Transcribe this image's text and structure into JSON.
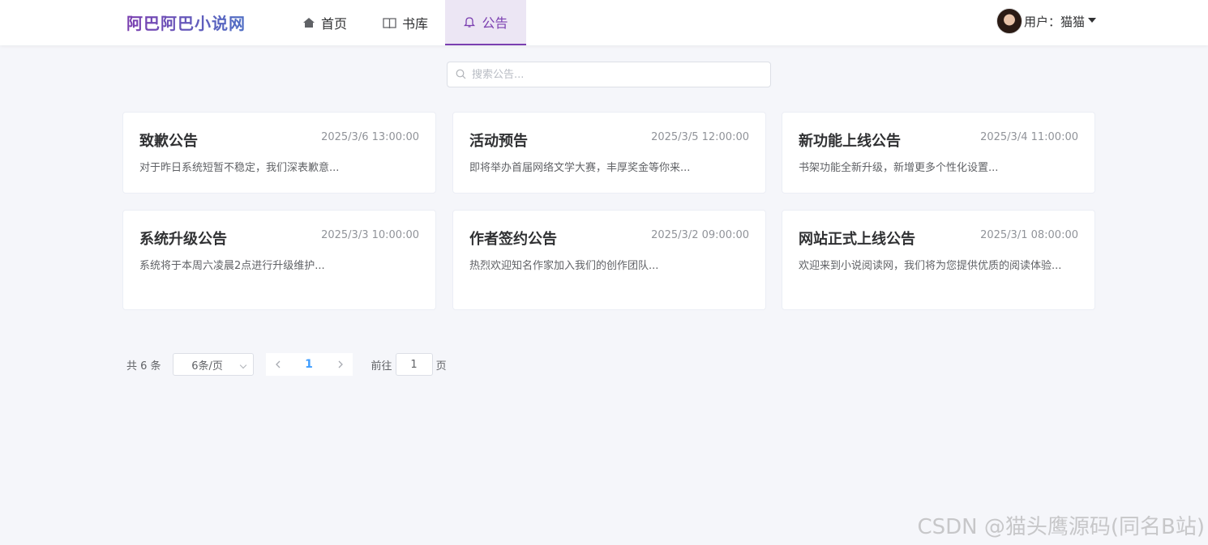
{
  "app": {
    "logo": "阿巴阿巴小说网"
  },
  "nav": {
    "home": "首页",
    "library": "书库",
    "notice": "公告"
  },
  "user": {
    "label": "用户：猫猫"
  },
  "search": {
    "placeholder": "搜索公告..."
  },
  "notices": [
    {
      "title": "致歉公告",
      "time": "2025/3/6 13:00:00",
      "desc": "对于昨日系统短暂不稳定，我们深表歉意..."
    },
    {
      "title": "活动预告",
      "time": "2025/3/5 12:00:00",
      "desc": "即将举办首届网络文学大赛，丰厚奖金等你来..."
    },
    {
      "title": "新功能上线公告",
      "time": "2025/3/4 11:00:00",
      "desc": "书架功能全新升级，新增更多个性化设置..."
    },
    {
      "title": "系统升级公告",
      "time": "2025/3/3 10:00:00",
      "desc": "系统将于本周六凌晨2点进行升级维护..."
    },
    {
      "title": "作者签约公告",
      "time": "2025/3/2 09:00:00",
      "desc": "热烈欢迎知名作家加入我们的创作团队..."
    },
    {
      "title": "网站正式上线公告",
      "time": "2025/3/1 08:00:00",
      "desc": "欢迎来到小说阅读网，我们将为您提供优质的阅读体验..."
    }
  ],
  "pagination": {
    "total": "共 6 条",
    "page_size": "6条/页",
    "current": "1",
    "goto_label": "前往",
    "goto_value": "1",
    "page_unit": "页"
  },
  "watermark": "CSDN @猫头鹰源码(同名B站)",
  "colors": {
    "accent": "#7b3fb0",
    "active_bg": "#ece6f4",
    "page_link": "#409eff"
  },
  "icons": {
    "home": "home-icon",
    "library": "book-icon",
    "notice": "bell-icon",
    "search": "search-icon"
  }
}
